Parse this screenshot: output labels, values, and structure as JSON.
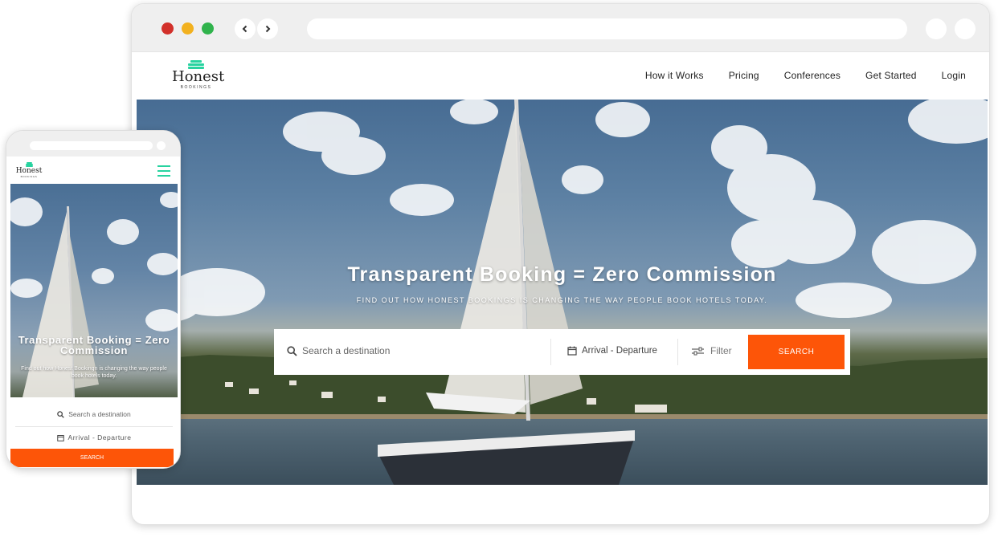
{
  "desktop": {
    "nav": {
      "logo_name": "Honest",
      "logo_sub": "BOOKINGS",
      "links": [
        "How it Works",
        "Pricing",
        "Conferences",
        "Get Started",
        "Login"
      ]
    },
    "hero": {
      "title": "Transparent Booking = Zero Commission",
      "subtitle": "FIND OUT HOW HONEST BOOKINGS IS CHANGING THE WAY PEOPLE BOOK HOTELS TODAY."
    },
    "search": {
      "destination_placeholder": "Search a destination",
      "dates_label": "Arrival - Departure",
      "filter_label": "Filter",
      "button_label": "SEARCH"
    }
  },
  "mobile": {
    "logo_name": "Honest",
    "logo_sub": "BOOKINGS",
    "hero": {
      "title": "Transparent Booking = Zero Commission",
      "subtitle": "Find out how Honest Bookingn is changing the way people book hotels today."
    },
    "search": {
      "destination_placeholder": "Search a destination",
      "dates_label": "Arrival - Departure",
      "button_label": "SEARCH"
    }
  },
  "colors": {
    "accent": "#fd5508",
    "brand": "#28d3a0",
    "window_close": "#d2302a",
    "window_minimize": "#f2b11f",
    "window_maximize": "#30b34c"
  },
  "icons": [
    "back-arrow-icon",
    "forward-arrow-icon",
    "logo-icon",
    "search-icon",
    "calendar-icon",
    "filter-icon",
    "hamburger-menu-icon"
  ]
}
